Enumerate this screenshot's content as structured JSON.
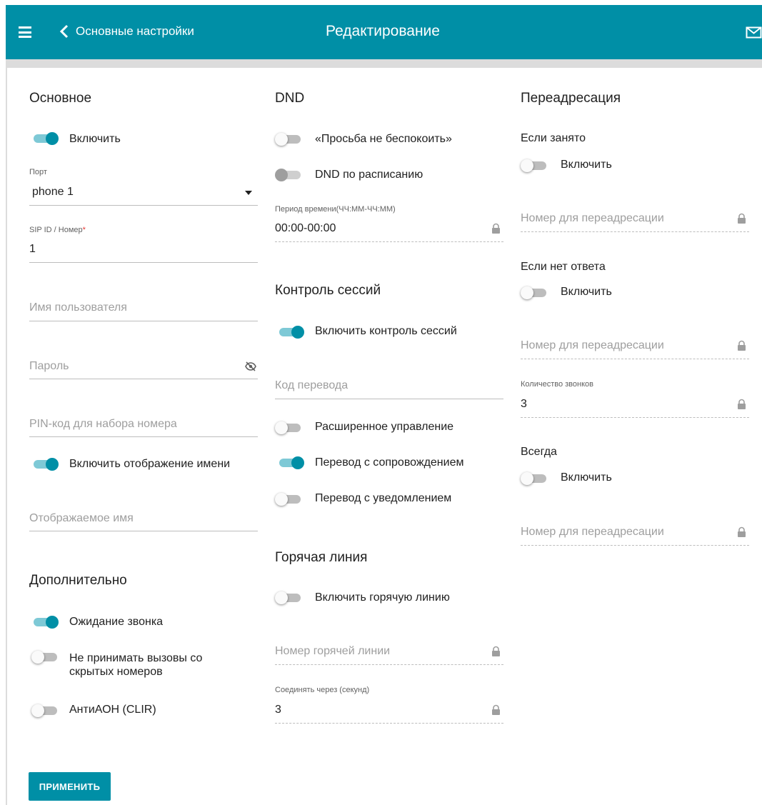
{
  "header": {
    "back_label": "Основные настройки",
    "title": "Редактирование"
  },
  "basic": {
    "title": "Основное",
    "enable_label": "Включить",
    "enable_on": true,
    "port_label": "Порт",
    "port_value": "phone 1",
    "sip_label": "SIP ID / Номер",
    "sip_required": "*",
    "sip_value": "1",
    "username_placeholder": "Имя пользователя",
    "password_placeholder": "Пароль",
    "pin_placeholder": "PIN-код для набора номера",
    "show_name_label": "Включить отображение имени",
    "show_name_on": true,
    "display_name_placeholder": "Отображаемое имя"
  },
  "additional": {
    "title": "Дополнительно",
    "call_waiting_label": "Ожидание звонка",
    "call_waiting_on": true,
    "reject_hidden_label_1": "Не принимать вызовы со",
    "reject_hidden_label_2": "скрытых номеров",
    "reject_hidden_on": false,
    "clir_label": "АнтиАОН (CLIR)",
    "clir_on": false
  },
  "dnd": {
    "title": "DND",
    "dnd_label": "«Просьба не беспокоить»",
    "dnd_on": false,
    "schedule_label": "DND по расписанию",
    "schedule_on": false,
    "period_label": "Период времени(ЧЧ:ММ-ЧЧ:ММ)",
    "period_value": "00:00-00:00"
  },
  "session": {
    "title": "Контроль сессий",
    "enable_label": "Включить контроль сессий",
    "enable_on": true,
    "transfer_code_placeholder": "Код перевода",
    "advanced_label": "Расширенное управление",
    "advanced_on": false,
    "attended_label": "Перевод с сопровождением",
    "attended_on": true,
    "notify_label": "Перевод с уведомлением",
    "notify_on": false
  },
  "hotline": {
    "title": "Горячая линия",
    "enable_label": "Включить горячую линию",
    "enable_on": false,
    "number_placeholder": "Номер горячей линии",
    "delay_label": "Соединять через (секунд)",
    "delay_value": "3"
  },
  "forward": {
    "title": "Переадресация",
    "busy_title": "Если занято",
    "busy_enable_label": "Включить",
    "busy_on": false,
    "busy_number_placeholder": "Номер для переадресации",
    "noanswer_title": "Если нет ответа",
    "noanswer_enable_label": "Включить",
    "noanswer_on": false,
    "noanswer_number_placeholder": "Номер для переадресации",
    "rings_label": "Количество звонков",
    "rings_value": "3",
    "always_title": "Всегда",
    "always_enable_label": "Включить",
    "always_on": false,
    "always_number_placeholder": "Номер для переадресации"
  },
  "apply_label": "ПРИМЕНИТЬ",
  "colors": {
    "accent": "#008fa6",
    "toggle_track_on": "#7ec9d6",
    "required": "#e53935"
  }
}
